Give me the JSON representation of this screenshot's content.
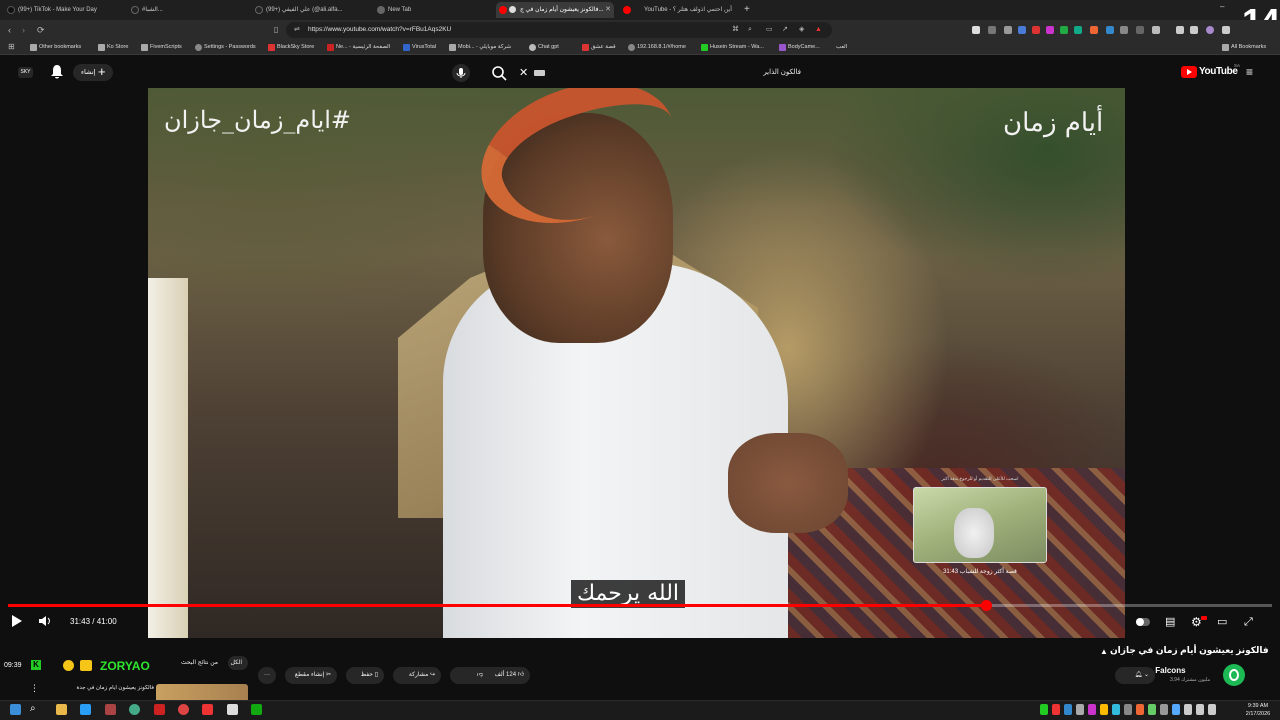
{
  "browser": {
    "tabs": [
      {
        "label": "(99+) TikTok - Make Your Day",
        "x": 0
      },
      {
        "label": "#الشبا...",
        "x": 0
      },
      {
        "label": "(99+) علي الفيفي (@ali.alfa...",
        "x": 0
      },
      {
        "label": "New Tab",
        "x": 0
      },
      {
        "label": "فالكونز يعيشون أيام زمان في ج...",
        "x": 0
      },
      {
        "label": "YouTube - أين احتمي اذولف هتلر ؟",
        "x": 0
      }
    ],
    "url": "https://www.youtube.com/watch?v=rFBu1Aqs2KU",
    "bookmarks": [
      "Other bookmarks",
      "Ko Store",
      "FivemScripts",
      "Settings - Passwords",
      "BlackSky Store",
      "Ne... - الصفحة الرئيسية",
      "VirusTotal",
      "Mobi... - شركة موبايلي",
      "Chat gpt",
      "قصة عشق",
      "192.168.8.1/#/home",
      "Husein Stream - Wa...",
      "BodyCame...",
      "العب"
    ],
    "all_bookmarks": "All Bookmarks"
  },
  "youtube": {
    "logo": "YouTube",
    "logo_region": "SA",
    "create_label": "إنشاء",
    "search_query": "فالكون الذاير",
    "video": {
      "watermark_left": "#ايام_زمان_جازان",
      "watermark_right": "أيام زمان",
      "caption": "الله يرحمك",
      "preview_hint": "اسحب للأعلى للتقديم أو للرجوع بدقة أكبر",
      "preview_time": "31:43",
      "preview_chapter": "قصة أكثر زوجة للشباب",
      "time": "31:43 / 41:00",
      "progress": 0.774
    },
    "title": "فالكونز يعيشون أيام زمان في جازان",
    "channel": "Falcons",
    "subscribers": "3.94 مليون مشترك",
    "actions": {
      "like_count": "124 ألف",
      "share": "مشاركة",
      "save": "حفظ",
      "clip": "إنشاء مقطع",
      "from_search": "من نتائج البحث",
      "all": "الكل"
    },
    "recommended_title": "فالكونز يعيشون أيام زمان في جدة"
  },
  "overlay": {
    "streamer_name": "ZORYAO",
    "counter": "14",
    "small_time": "09:39"
  },
  "taskbar": {
    "time": "9:39 AM",
    "date": "2/17/2026"
  }
}
